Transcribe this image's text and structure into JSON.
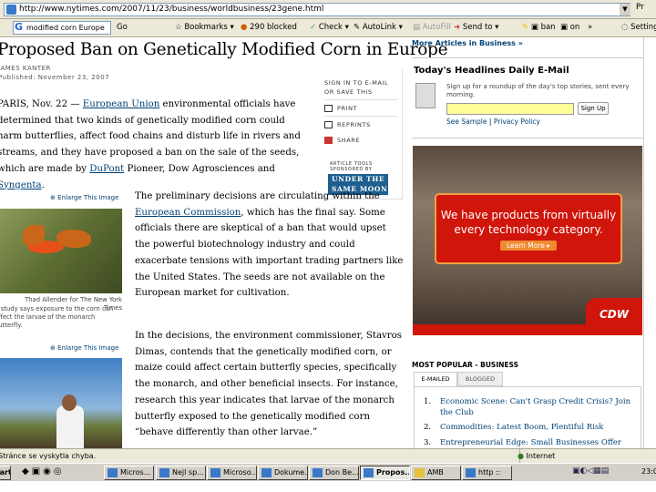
{
  "browser": {
    "url": "http://www.nytimes.com/2007/11/23/business/worldbusiness/23gene.html",
    "go_label": "Pr",
    "toolbar": {
      "search_value": "modified corn Europe",
      "go": "Go",
      "bookmarks": "Bookmarks",
      "blocked": "290 blocked",
      "check": "Check",
      "autolink": "AutoLink",
      "autofill": "AutoFill",
      "send_to": "Send to",
      "ban": "ban",
      "on": "on",
      "more": "»",
      "settings": "Settings"
    }
  },
  "article": {
    "title": "Proposed Ban on Genetically Modified Corn in Europe",
    "byline": "JAMES KANTER",
    "published": "Published: November 23, 2007",
    "p1_a": "PARIS, Nov. 22 — ",
    "p1_link1": "European Union",
    "p1_b": " environmental officials have determined that two kinds of genetically modified corn could harm butterflies, affect food chains and disturb life in rivers and streams, and they have proposed a ban on the sale of the seeds, which are made by ",
    "p1_link2": "DuPont",
    "p1_c": " Pioneer, Dow Agrosciences and ",
    "p1_link3": "Syngenta",
    "p1_d": ".",
    "p2_a": "The preliminary decisions are circulating within the ",
    "p2_link": "European Commission",
    "p2_b": ", which has the final say. Some officials there are skeptical of a ban that would upset the powerful biotechnology industry and could exacerbate tensions with important trading partners like the United States. The seeds are not available on the European market for cultivation.",
    "p3": "In the decisions, the environment commissioner, Stavros Dimas, contends that the genetically modified corn, or maize could affect certain butterfly species, specifically the monarch, and other beneficial insects. For instance, research this year indicates that larvae of the monarch butterfly exposed to the genetically modified corn “behave differently than other larvae.”",
    "enlarge1": "Enlarge This Image",
    "credit1": "Thad Allender for The New York Times",
    "caption1": "A study says exposure to the corn can affect the larvae of the monarch butterfly.",
    "enlarge2": "Enlarge This Image"
  },
  "tools": {
    "signin": "SIGN IN TO E-MAIL OR SAVE THIS",
    "print": "PRINT",
    "reprints": "REPRINTS",
    "share": "SHARE",
    "sponsor_label": "ARTICLE TOOLS SPONSORED BY",
    "sponsor_logo": "UNDER THE SAME MOON"
  },
  "sidebar": {
    "more_articles": "More Articles in Business »",
    "newsletter_title": "Today's Headlines Daily E-Mail",
    "newsletter_desc": "Sign up for a roundup of the day's top stories, sent every morning.",
    "email_value": "",
    "signup": "Sign Up",
    "see_sample": "See Sample",
    "sep": "|",
    "privacy": "Privacy Policy",
    "ad_text": "We have products from virtually every technology category.",
    "ad_button": "Learn More ▸",
    "ad_logo": "CDW",
    "most_popular": "MOST POPULAR - BUSINESS",
    "tabs": [
      "E-MAILED",
      "BLOGGED"
    ],
    "popular": [
      {
        "n": "1.",
        "title": "Economic Scene: Can't Grasp Credit Crisis? Join the Club"
      },
      {
        "n": "2.",
        "title": "Commodities: Latest Boom, Plentiful Risk"
      },
      {
        "n": "3.",
        "title": "Entrepreneurial Edge: Small Businesses Offer"
      }
    ]
  },
  "status": {
    "text": "Stránce se vyskytla chyba.",
    "zone": "Internet"
  },
  "taskbar": {
    "start": "Start",
    "items": [
      "Micros...",
      "Nejl sp...",
      "Microso...",
      "Dokume...",
      "Don Be...",
      "Propos...",
      "AMB",
      "http ::"
    ],
    "clock": "23:0"
  },
  "colors": {
    "link": "#004276",
    "ad_red": "#d0150b"
  }
}
